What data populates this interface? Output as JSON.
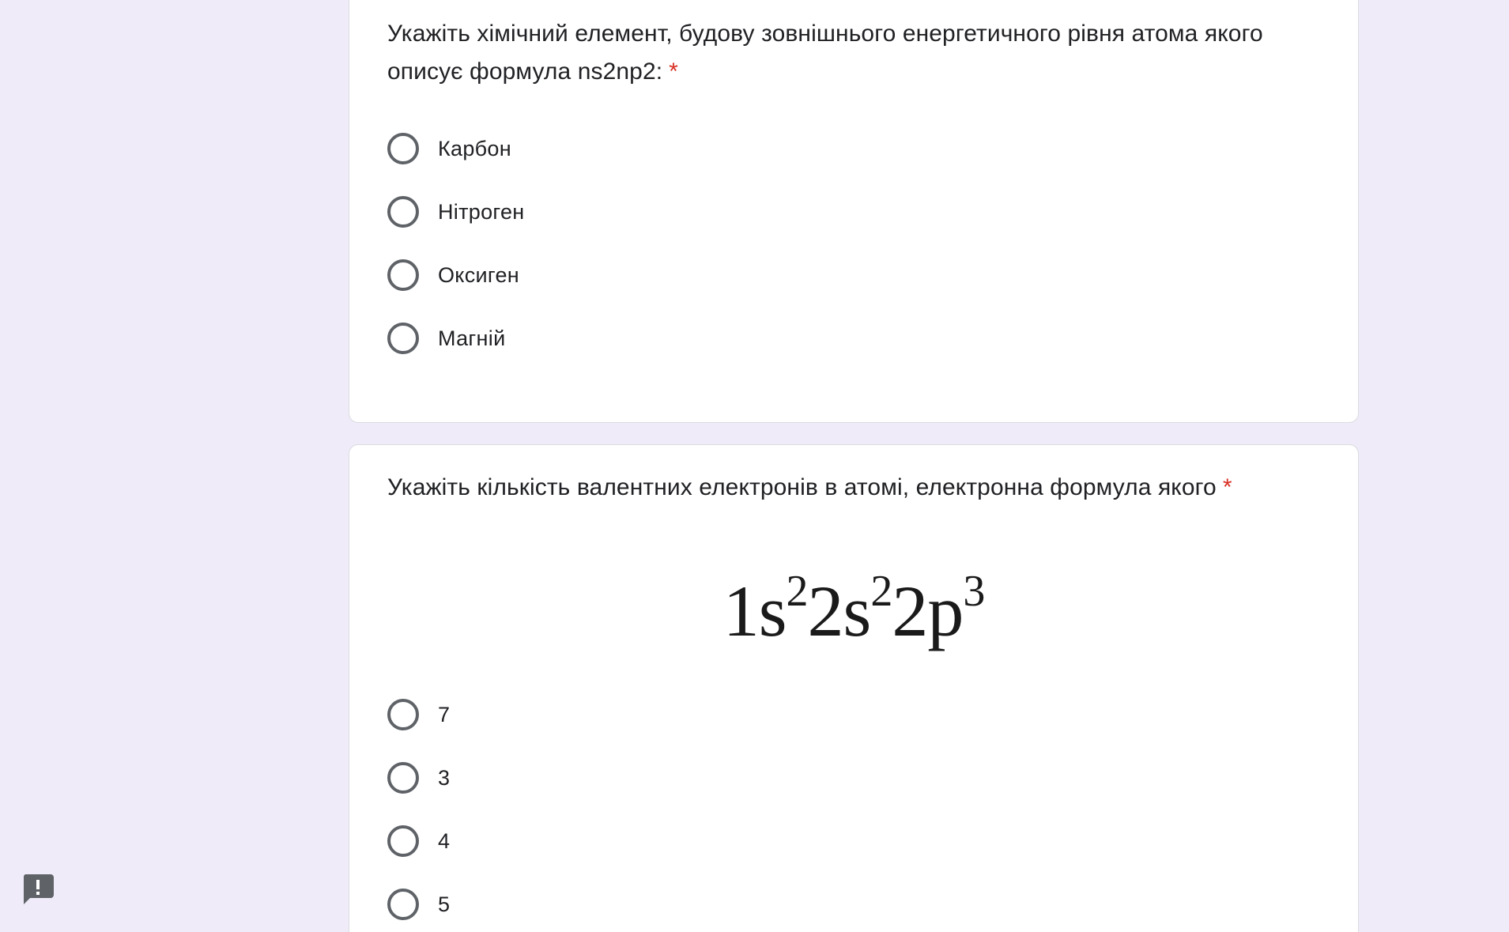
{
  "questions": [
    {
      "title": "Укажіть хімічний елемент, будову зовнішнього енергетичного рівня атома якого описує формула ns2np2:",
      "required_marker": "*",
      "options": [
        "Карбон",
        "Нітроген",
        "Оксиген",
        "Магній"
      ]
    },
    {
      "title": "Укажіть кількість валентних електронів в атомі, електронна формула якого",
      "required_marker": "*",
      "formula": {
        "parts": [
          {
            "base": "1s",
            "sup": "2"
          },
          {
            "base": "2s",
            "sup": "2"
          },
          {
            "base": "2p",
            "sup": "3"
          }
        ]
      },
      "options": [
        "7",
        "3",
        "4",
        "5"
      ]
    }
  ],
  "feedback": {
    "icon": "report-issue-icon",
    "color": "#5f6368"
  },
  "colors": {
    "background": "#efebf8",
    "card": "#ffffff",
    "required": "#d93025",
    "radio_border": "#5f6368"
  }
}
